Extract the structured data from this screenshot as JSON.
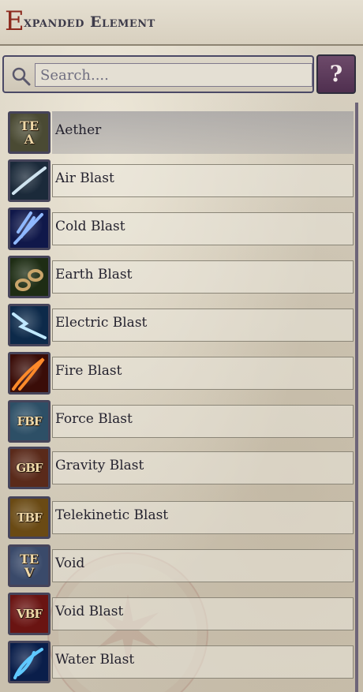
{
  "header": {
    "title_initial": "E",
    "title_rest": "xpanded Element"
  },
  "search": {
    "placeholder": "Search....",
    "value": ""
  },
  "help": {
    "glyph": "?",
    "icon": "help-question-icon"
  },
  "items": [
    {
      "label": "Aether",
      "abbr": "TE A",
      "icon": "aether-icon",
      "bg": "#4a4a33",
      "selected": true
    },
    {
      "label": "Air Blast",
      "abbr": "",
      "icon": "air-blast-icon",
      "bg": "#1b2a3a",
      "selected": false
    },
    {
      "label": "Cold Blast",
      "abbr": "",
      "icon": "cold-blast-icon",
      "bg": "#10184a",
      "selected": false
    },
    {
      "label": "Earth Blast",
      "abbr": "",
      "icon": "earth-blast-icon",
      "bg": "#1e2d14",
      "selected": false
    },
    {
      "label": "Electric Blast",
      "abbr": "",
      "icon": "electric-blast-icon",
      "bg": "#0d2a4a",
      "selected": false
    },
    {
      "label": "Fire Blast",
      "abbr": "",
      "icon": "fire-blast-icon",
      "bg": "#3a0d08",
      "selected": false
    },
    {
      "label": "Force Blast",
      "abbr": "FBF",
      "icon": "force-blast-icon",
      "bg": "#2d4f66",
      "selected": false
    },
    {
      "label": "Gravity Blast",
      "abbr": "GBF",
      "icon": "gravity-blast-icon",
      "bg": "#5a2a1a",
      "selected": false
    },
    {
      "label": "Telekinetic Blast",
      "abbr": "TBF",
      "icon": "telekinetic-blast-icon",
      "bg": "#6a4a14",
      "selected": false
    },
    {
      "label": "Void",
      "abbr": "TE V",
      "icon": "void-icon",
      "bg": "#3a4a6a",
      "selected": false
    },
    {
      "label": "Void Blast",
      "abbr": "VBF",
      "icon": "void-blast-icon",
      "bg": "#6a1412",
      "selected": false
    },
    {
      "label": "Water Blast",
      "abbr": "",
      "icon": "water-blast-icon",
      "bg": "#0a1e4a",
      "selected": false
    }
  ]
}
